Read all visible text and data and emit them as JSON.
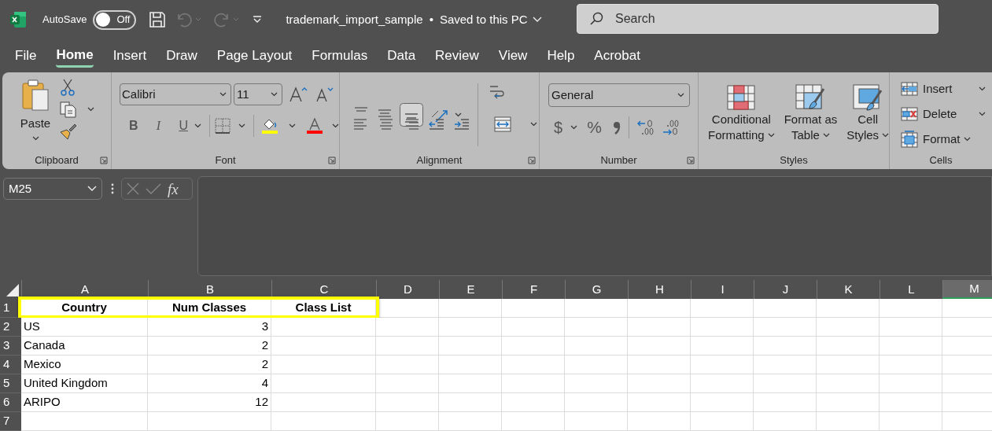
{
  "title_bar": {
    "autosave_label": "AutoSave",
    "autosave": {
      "label": "Off",
      "on": false
    },
    "document_title": "trademark_import_sample",
    "separator": "•",
    "save_status": "Saved to this PC",
    "search": {
      "placeholder": "Search"
    }
  },
  "tabs": [
    {
      "label": "File",
      "selected": false
    },
    {
      "label": "Home",
      "selected": true
    },
    {
      "label": "Insert",
      "selected": false
    },
    {
      "label": "Draw",
      "selected": false
    },
    {
      "label": "Page Layout",
      "selected": false
    },
    {
      "label": "Formulas",
      "selected": false
    },
    {
      "label": "Data",
      "selected": false
    },
    {
      "label": "Review",
      "selected": false
    },
    {
      "label": "View",
      "selected": false
    },
    {
      "label": "Help",
      "selected": false
    },
    {
      "label": "Acrobat",
      "selected": false
    }
  ],
  "ribbon": {
    "groups": [
      {
        "kind": "clipboard",
        "label": "Clipboard",
        "paste_label": "Paste"
      },
      {
        "kind": "font",
        "label": "Font",
        "font_name": "Calibri",
        "font_size": "11",
        "bold": "B",
        "italic": "I",
        "underline": "U"
      },
      {
        "kind": "alignment",
        "label": "Alignment"
      },
      {
        "kind": "number",
        "label": "Number",
        "format": "General",
        "currency": "$",
        "percent": "%"
      },
      {
        "kind": "styles",
        "label": "Styles",
        "buttons": [
          {
            "lines": [
              "Conditional",
              "Formatting"
            ]
          },
          {
            "lines": [
              "Format as",
              "Table"
            ]
          },
          {
            "lines": [
              "Cell",
              "Styles"
            ]
          }
        ]
      },
      {
        "kind": "cells",
        "label": "Cells",
        "buttons": [
          "Insert",
          "Delete",
          "Format"
        ]
      }
    ]
  },
  "formula_bar": {
    "name_box": "M25",
    "function_label": "fx"
  },
  "sheet": {
    "columns": [
      {
        "label": "A",
        "selected": false
      },
      {
        "label": "B",
        "selected": false
      },
      {
        "label": "C",
        "selected": false
      },
      {
        "label": "D",
        "selected": false
      },
      {
        "label": "E",
        "selected": false
      },
      {
        "label": "F",
        "selected": false
      },
      {
        "label": "G",
        "selected": false
      },
      {
        "label": "H",
        "selected": false
      },
      {
        "label": "I",
        "selected": false
      },
      {
        "label": "J",
        "selected": false
      },
      {
        "label": "K",
        "selected": false
      },
      {
        "label": "L",
        "selected": false
      },
      {
        "label": "M",
        "selected": true
      }
    ],
    "rows": [
      {
        "number": "1",
        "kind": "header",
        "highlighted": true,
        "cells": [
          {
            "text": "Country"
          },
          {
            "text": "Num Classes"
          },
          {
            "text": "Class List"
          }
        ]
      },
      {
        "number": "2",
        "kind": "data",
        "highlighted": false,
        "cells": [
          {
            "text": "US",
            "kind": "text"
          },
          {
            "text": "3",
            "kind": "number"
          }
        ]
      },
      {
        "number": "3",
        "kind": "data",
        "highlighted": false,
        "cells": [
          {
            "text": "Canada",
            "kind": "text"
          },
          {
            "text": "2",
            "kind": "number"
          }
        ]
      },
      {
        "number": "4",
        "kind": "data",
        "highlighted": false,
        "cells": [
          {
            "text": "Mexico",
            "kind": "text"
          },
          {
            "text": "2",
            "kind": "number"
          }
        ]
      },
      {
        "number": "5",
        "kind": "data",
        "highlighted": false,
        "cells": [
          {
            "text": "United Kingdom",
            "kind": "text"
          },
          {
            "text": "4",
            "kind": "number"
          }
        ]
      },
      {
        "number": "6",
        "kind": "data",
        "highlighted": false,
        "cells": [
          {
            "text": "ARIPO",
            "kind": "text"
          },
          {
            "text": "12",
            "kind": "number"
          }
        ]
      },
      {
        "number": "7",
        "highlighted": false,
        "cells": []
      }
    ]
  }
}
